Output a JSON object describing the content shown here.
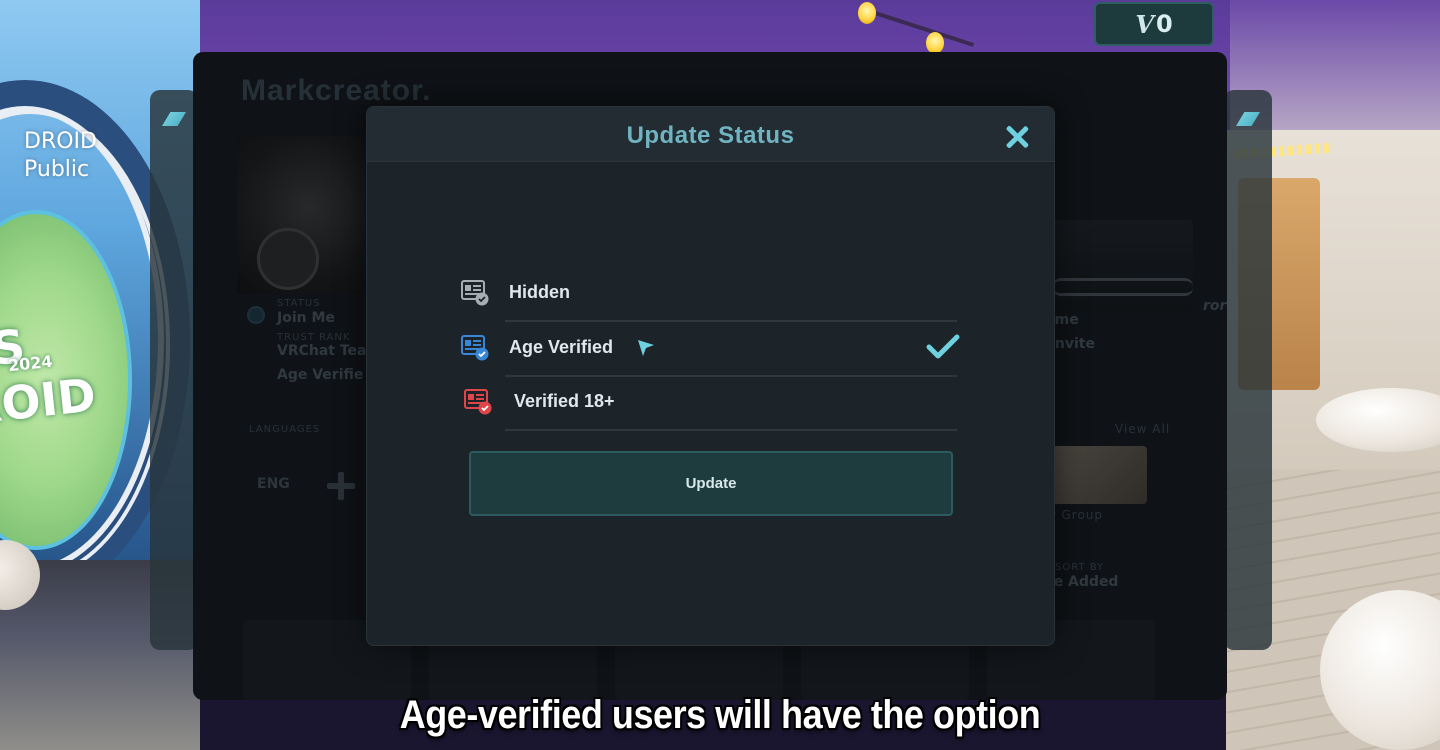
{
  "balance": {
    "symbol": "V",
    "amount": "0"
  },
  "background_sign": {
    "line1": "DROID",
    "line2": "Public",
    "disc_text": "A\nES\nROID",
    "disc_small": "2024"
  },
  "profile": {
    "name": "Markcreator.",
    "status_label": "STATUS",
    "status_value": "Join Me",
    "rank_label": "TRUST RANK",
    "rank_value": "VRChat Tea",
    "age_value": "Age Verifie",
    "languages_label": "LANGUAGES",
    "language": "ENG",
    "world_title": "ome",
    "world_sub": "- Invite",
    "groups_view_all": "View All",
    "group_name": "rr Group",
    "sort_label": "SORT BY",
    "sort_value": "te Added",
    "right_name": "ror"
  },
  "dialog": {
    "title": "Update Status",
    "options": [
      {
        "label": "Hidden",
        "icon": "id-card-gray-icon",
        "selected": false
      },
      {
        "label": "Age Verified",
        "icon": "id-card-blue-icon",
        "selected": true
      },
      {
        "label": "Verified 18+",
        "icon": "id-card-red-icon",
        "selected": false
      }
    ],
    "update_label": "Update"
  },
  "caption": "Age-verified users will have the option",
  "colors": {
    "accent": "#6fb4c0",
    "close": "#6fd0e0",
    "check": "#6fd0e0",
    "id_gray": "#a7aeb2",
    "id_blue": "#3a86d6",
    "id_red": "#e0454a"
  }
}
